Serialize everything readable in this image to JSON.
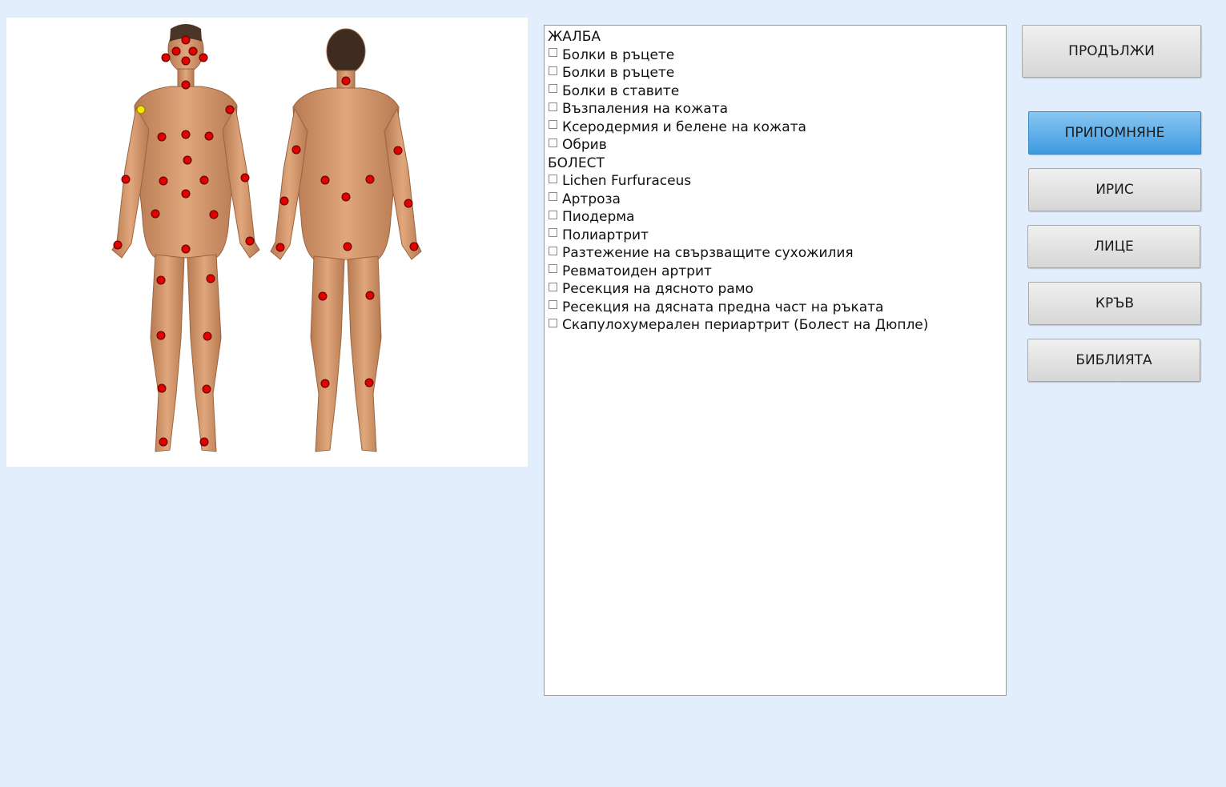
{
  "body_map": {
    "front_view": "front-body-figure",
    "back_view": "back-body-figure",
    "point_color": "#e00000",
    "selected_point_color": "#f5e600"
  },
  "symptoms": {
    "groups": [
      {
        "title": "ЖАЛБА",
        "items": [
          "Болки в ръцете",
          "Болки в ръцете",
          "Болки в ставите",
          "Възпаления на кожата",
          "Ксеродермия и белене на кожата",
          "Обрив"
        ]
      },
      {
        "title": "БОЛЕСТ",
        "items": [
          "Lichen Furfuraceus",
          "Артроза",
          "Пиодерма",
          "Полиартрит",
          "Разтежение на свързващите сухожилия",
          "Ревматоиден артрит",
          "Ресекция  на дясното рамо",
          "Ресекция на дясната предна част на ръката",
          "Скапулохумерален периартрит (Болест на Дюпле)"
        ]
      }
    ]
  },
  "buttons": {
    "continue": "ПРОДЪЛЖИ",
    "reminder": "ПРИПОМНЯНЕ",
    "iris": "ИРИС",
    "face": "ЛИЦЕ",
    "blood": "КРЪВ",
    "library": "БИБЛИЯТА"
  },
  "colors": {
    "background": "#e3eefc",
    "active_button": "#4fa7e6"
  }
}
